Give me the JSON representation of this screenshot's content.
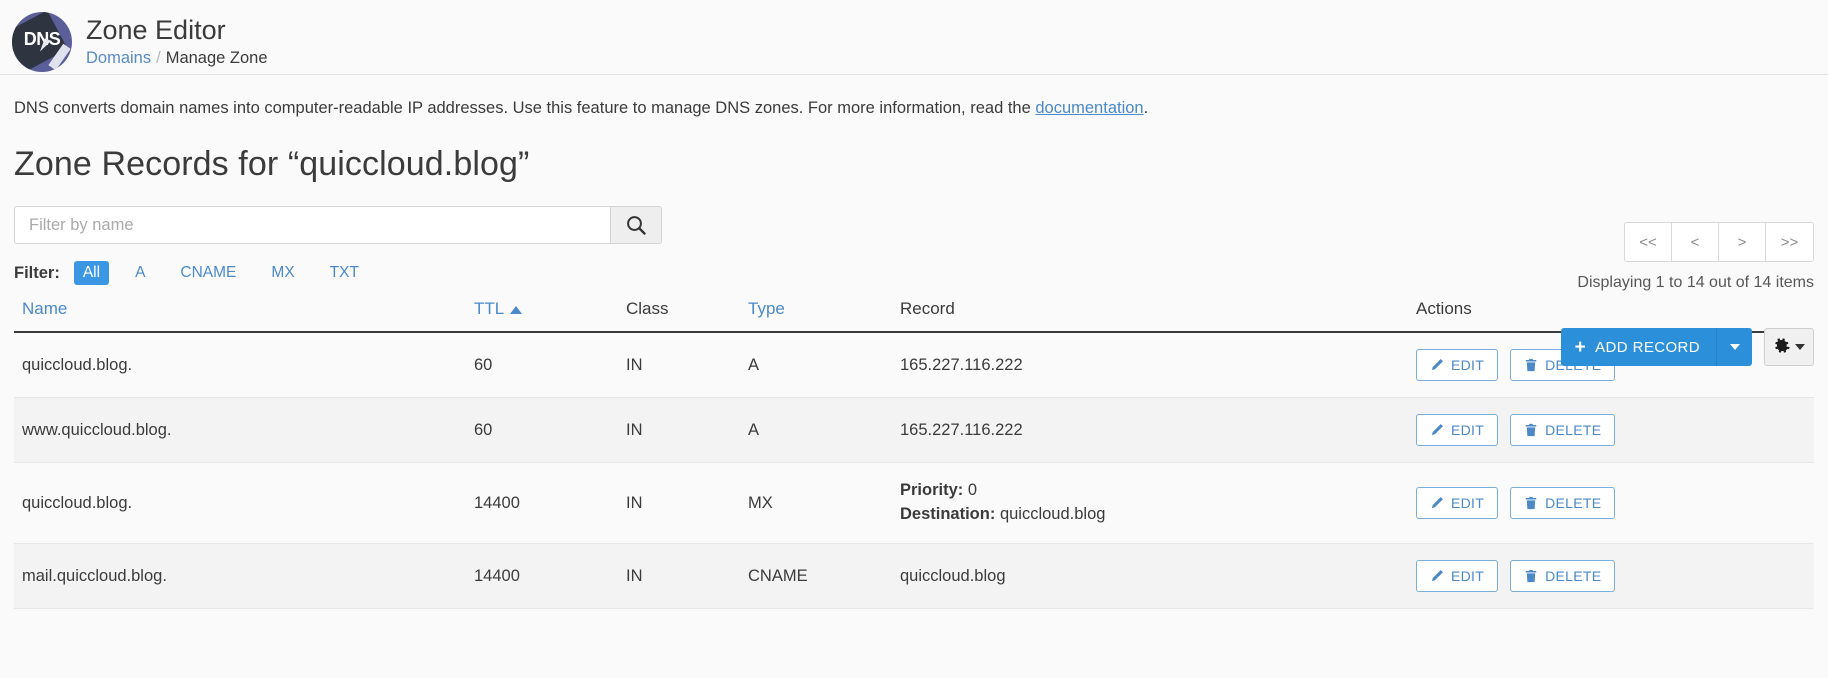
{
  "header": {
    "logo_text": "DNS",
    "title": "Zone Editor",
    "breadcrumb": {
      "root": "Domains",
      "separator": "/",
      "current": "Manage Zone"
    }
  },
  "intro": {
    "text_before": "DNS converts domain names into computer-readable IP addresses. Use this feature to manage DNS zones. For more information, read the ",
    "link": "documentation",
    "text_after": "."
  },
  "zone": {
    "title": "Zone Records for “quiccloud.blog”"
  },
  "search": {
    "placeholder": "Filter by name",
    "value": "",
    "button_icon": "search-icon"
  },
  "filter": {
    "label": "Filter:",
    "options": [
      "All",
      "A",
      "CNAME",
      "MX",
      "TXT"
    ],
    "active": "All"
  },
  "pagination": {
    "first": "<<",
    "prev": "<",
    "next": ">",
    "last": ">>",
    "status": "Displaying 1 to 14 out of 14 items"
  },
  "toolbar": {
    "add_record_label": "ADD RECORD",
    "add_record_plus": "+",
    "gear_icon": "gear-icon"
  },
  "table": {
    "columns": [
      {
        "key": "name",
        "label": "Name",
        "link": true,
        "sorted": false
      },
      {
        "key": "ttl",
        "label": "TTL",
        "link": true,
        "sorted": true
      },
      {
        "key": "class",
        "label": "Class",
        "link": false,
        "sorted": false
      },
      {
        "key": "type",
        "label": "Type",
        "link": true,
        "sorted": false
      },
      {
        "key": "record",
        "label": "Record",
        "link": false,
        "sorted": false
      },
      {
        "key": "actions",
        "label": "Actions",
        "link": false,
        "sorted": false
      }
    ],
    "actions": {
      "edit_label": "EDIT",
      "delete_label": "DELETE"
    },
    "rows": [
      {
        "name": "quiccloud.blog.",
        "ttl": "60",
        "class": "IN",
        "type": "A",
        "record": "165.227.116.222",
        "record_pairs": []
      },
      {
        "name": "www.quiccloud.blog.",
        "ttl": "60",
        "class": "IN",
        "type": "A",
        "record": "165.227.116.222",
        "record_pairs": []
      },
      {
        "name": "quiccloud.blog.",
        "ttl": "14400",
        "class": "IN",
        "type": "MX",
        "record": "",
        "record_pairs": [
          {
            "label": "Priority:",
            "value": "0"
          },
          {
            "label": "Destination:",
            "value": "quiccloud.blog"
          }
        ]
      },
      {
        "name": "mail.quiccloud.blog.",
        "ttl": "14400",
        "class": "IN",
        "type": "CNAME",
        "record": "quiccloud.blog",
        "record_pairs": []
      }
    ]
  }
}
